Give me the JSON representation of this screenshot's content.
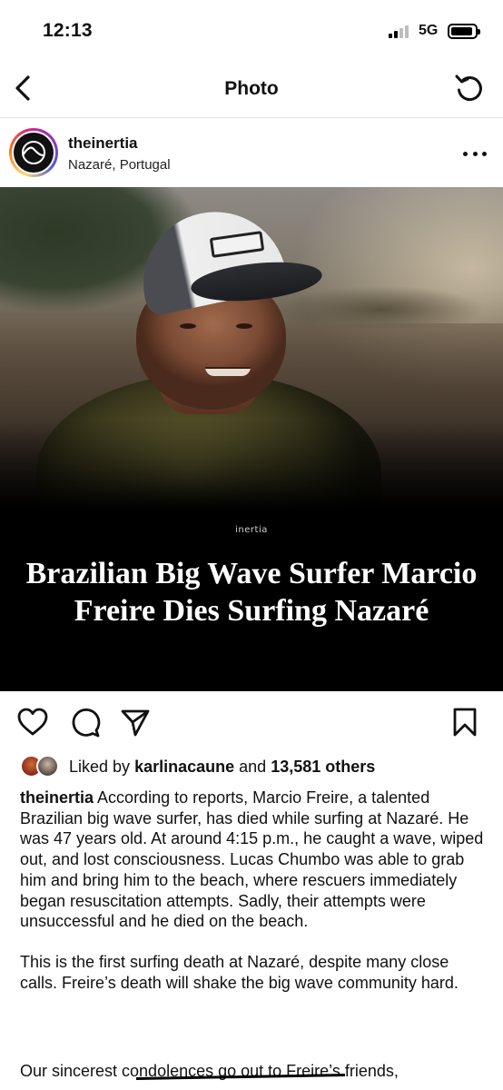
{
  "status_bar": {
    "time": "12:13",
    "network": "5G"
  },
  "nav": {
    "title": "Photo"
  },
  "post": {
    "username": "theinertia",
    "location": "Nazaré, Portugal",
    "image": {
      "watermark": "inertia",
      "headline": "Brazilian Big Wave Surfer Marcio Freire Dies Surfing Nazaré"
    }
  },
  "likes": {
    "prefix": "Liked by",
    "first_user": "karlinacaune",
    "conjunction": "and",
    "others": "13,581 others"
  },
  "caption": {
    "username": "theinertia",
    "paragraph1": "According to reports, Marcio Freire, a talented Brazilian big wave surfer, has died while surfing at Nazaré. He was 47 years old. At around 4:15 p.m., he caught a wave, wiped out, and lost consciousness. Lucas Chumbo was able to grab him and bring him to the beach, where rescuers immediately began resuscitation attempts. Sadly, their attempts were unsuccessful and he died on the beach.",
    "paragraph2": "This is the first surfing death at Nazaré, despite many close calls. Freire’s death will shake the big wave community hard.",
    "paragraph3_partial": "Our sincerest condolences go out to Freire’s friends,"
  },
  "icons": {
    "back": "chevron-left-icon",
    "refresh": "refresh-icon",
    "more": "more-horizontal-icon",
    "like": "heart-icon",
    "comment": "comment-icon",
    "share": "send-icon",
    "save": "bookmark-icon"
  },
  "colors": {
    "story_ring": [
      "#feda75",
      "#fa7e1e",
      "#d62976",
      "#962fbf",
      "#4f5bd5"
    ],
    "headline_bg": "#000000",
    "headline_text": "#ffffff"
  }
}
